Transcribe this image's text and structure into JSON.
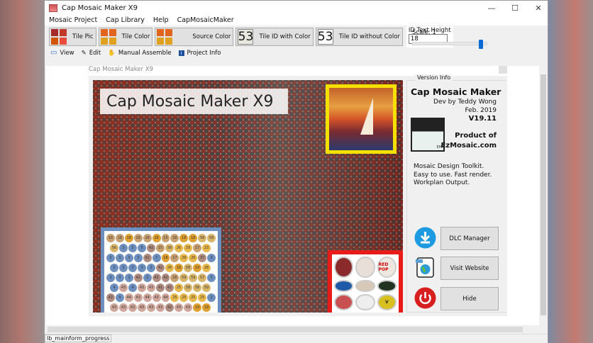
{
  "window": {
    "title": "Cap Mosaic Maker X9",
    "minimize": "—",
    "maximize": "☐",
    "close": "✕"
  },
  "menu": [
    "Mosaic Project",
    "Cap Library",
    "Help",
    "CapMosaicMaker"
  ],
  "toolbar": {
    "tile_pic": "Tile Pic",
    "tile_color": "Tile Color",
    "source_color": "Source Color",
    "tile_id_with_color": "Tile ID with Color",
    "tile_id_without_color": "Tile ID without Color",
    "id_sample": "53",
    "id_text_height_label": "ID Text Height",
    "id_text_height_value": "18",
    "scale_label": "Scale: 1",
    "scale_slider_fraction": 0.93
  },
  "tabs": [
    "View",
    "Edit",
    "Manual Assemble",
    "Project Info"
  ],
  "dialog": {
    "title": "Cap Mosaic Maker X9",
    "mosaic_title": "Cap Mosaic Maker X9",
    "inset_rows": [
      [
        "16",
        "16",
        "18",
        "16",
        "16",
        "18",
        "15",
        "16",
        "18",
        "18",
        "58",
        "58"
      ],
      [
        "56",
        "2",
        "5",
        "9",
        "42",
        "15",
        "58",
        "26",
        "29",
        "17",
        "23"
      ],
      [
        "3",
        "3",
        "3",
        "3",
        "42",
        "7",
        "18",
        "17",
        "26",
        "26",
        "37",
        "3"
      ],
      [
        "3",
        "3",
        "3",
        "3",
        "3",
        "42",
        "26",
        "18",
        "58",
        "19",
        "28"
      ],
      [
        "3",
        "3",
        "3",
        "42",
        "3",
        "42",
        "42",
        "16",
        "59",
        "59",
        "57",
        "5"
      ],
      [
        "4",
        "43",
        "4",
        "43",
        "43",
        "41",
        "42",
        "25",
        "58",
        "58",
        "59"
      ],
      [
        "42",
        "4",
        "44",
        "43",
        "44",
        "43",
        "44",
        "25",
        "25",
        "25",
        "25",
        "2"
      ],
      [
        "43",
        "43",
        "43",
        "43",
        "43",
        "43",
        "42",
        "43",
        "43",
        "19",
        "19"
      ]
    ],
    "red_box_caps": [
      "",
      "",
      "RED POP",
      "",
      "",
      "",
      "",
      "",
      "V"
    ],
    "version": {
      "label": "Version Info",
      "name": "Cap Mosaic Maker",
      "dev": "Dev by Teddy Wong",
      "date": "Feb. 2019",
      "version": "V19.11",
      "product_of": "Product of",
      "site": "EzMosaic.com",
      "logo_text": "EM",
      "desc": [
        "Mosaic Design Toolkit.",
        "Easy to use. Fast render.",
        "Workplan Output."
      ]
    },
    "buttons": {
      "dlc": "DLC Manager",
      "visit": "Visit Website",
      "hide": "Hide"
    }
  },
  "status": "lb_mainform_progress",
  "colors": {
    "accent": "#0a68d6",
    "dlc_icon": "#1e9be0",
    "hide_icon": "#d81e1e",
    "painting_border": "#f5e000",
    "red_box": "#e81b1b",
    "inset_border": "#6b8fbf"
  }
}
